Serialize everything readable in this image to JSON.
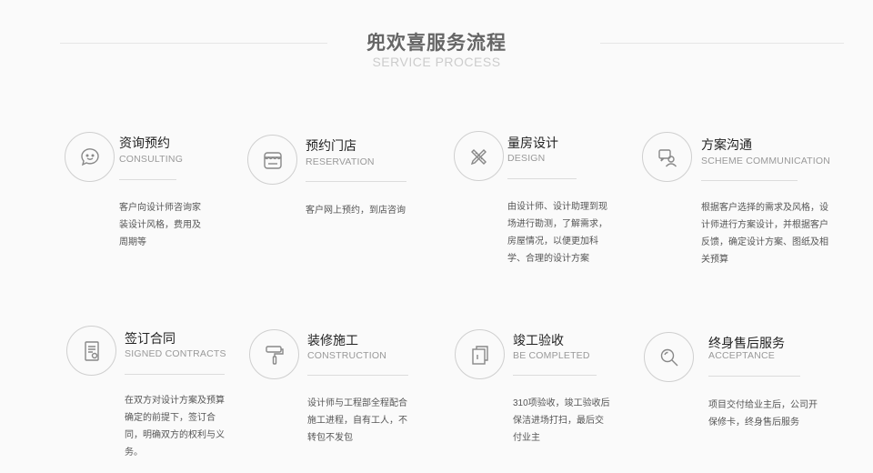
{
  "header": {
    "title": "兜欢喜服务流程",
    "subtitle": "SERVICE PROCESS"
  },
  "steps": [
    {
      "name": "资询预约",
      "en": "CONSULTING",
      "icon": "chat-bubble-icon",
      "desc": "客户向设计师咨询家装设计风格，费用及周期等"
    },
    {
      "name": "预约门店",
      "en": "RESERVATION",
      "icon": "storefront-icon",
      "desc": "客户网上预约，到店咨询"
    },
    {
      "name": "量房设计",
      "en": "DESIGN",
      "icon": "pencil-ruler-icon",
      "desc": "由设计师、设计助理到现场进行勘测，了解需求，房屋情况，以便更加科学、合理的设计方案"
    },
    {
      "name": "方案沟通",
      "en": "SCHEME COMMUNICATION",
      "icon": "discussion-icon",
      "desc": "根据客户选择的需求及风格，设计师进行方案设计，并根据客户反馈，确定设计方案、图纸及相关预算"
    },
    {
      "name": "签订合同",
      "en": "SIGNED CONTRACTS",
      "icon": "contract-icon",
      "desc": "在双方对设计方案及预算确定的前提下，签订合同，明确双方的权利与义务。"
    },
    {
      "name": "装修施工",
      "en": "CONSTRUCTION",
      "icon": "paint-roller-icon",
      "desc": "设计师与工程部全程配合施工进程，自有工人，不转包不发包"
    },
    {
      "name": "竣工验收",
      "en": "BE COMPLETED",
      "icon": "documents-icon",
      "desc": "310项验收，竣工验收后保洁进场打扫，最后交付业主"
    },
    {
      "name": "终身售后服务",
      "en": "ACCEPTANCE",
      "icon": "magnifier-icon",
      "desc": "项目交付给业主后，公司开保修卡，终身售后服务"
    }
  ]
}
